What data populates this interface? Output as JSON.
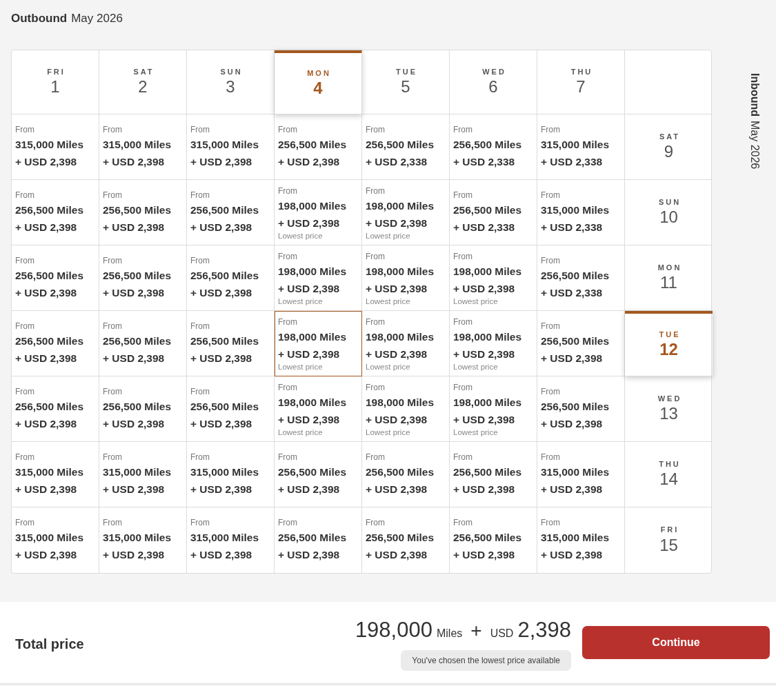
{
  "outbound": {
    "label": "Outbound",
    "month": "May 2026"
  },
  "inbound": {
    "label": "Inbound",
    "month": "May 2026"
  },
  "columns": [
    {
      "dow": "FRI",
      "day": "1",
      "selected": false
    },
    {
      "dow": "SAT",
      "day": "2",
      "selected": false
    },
    {
      "dow": "SUN",
      "day": "3",
      "selected": false
    },
    {
      "dow": "MON",
      "day": "4",
      "selected": true
    },
    {
      "dow": "TUE",
      "day": "5",
      "selected": false
    },
    {
      "dow": "WED",
      "day": "6",
      "selected": false
    },
    {
      "dow": "THU",
      "day": "7",
      "selected": false
    }
  ],
  "rows": [
    {
      "dow": "SAT",
      "day": "9",
      "selected": false,
      "cells": [
        {
          "from": "From",
          "miles": "315,000 Miles",
          "usd": "+ USD 2,398",
          "selected": false
        },
        {
          "from": "From",
          "miles": "315,000 Miles",
          "usd": "+ USD 2,398",
          "selected": false
        },
        {
          "from": "From",
          "miles": "315,000 Miles",
          "usd": "+ USD 2,398",
          "selected": false
        },
        {
          "from": "From",
          "miles": "256,500 Miles",
          "usd": "+ USD 2,398",
          "selected": false
        },
        {
          "from": "From",
          "miles": "256,500 Miles",
          "usd": "+ USD 2,338",
          "selected": false
        },
        {
          "from": "From",
          "miles": "256,500 Miles",
          "usd": "+ USD 2,338",
          "selected": false
        },
        {
          "from": "From",
          "miles": "315,000 Miles",
          "usd": "+ USD 2,338",
          "selected": false
        }
      ]
    },
    {
      "dow": "SUN",
      "day": "10",
      "selected": false,
      "cells": [
        {
          "from": "From",
          "miles": "256,500 Miles",
          "usd": "+ USD 2,398",
          "selected": false
        },
        {
          "from": "From",
          "miles": "256,500 Miles",
          "usd": "+ USD 2,398",
          "selected": false
        },
        {
          "from": "From",
          "miles": "256,500 Miles",
          "usd": "+ USD 2,398",
          "selected": false
        },
        {
          "from": "From",
          "miles": "198,000 Miles",
          "usd": "+ USD 2,398",
          "note": "Lowest price",
          "selected": false
        },
        {
          "from": "From",
          "miles": "198,000 Miles",
          "usd": "+ USD 2,398",
          "note": "Lowest price",
          "selected": false
        },
        {
          "from": "From",
          "miles": "256,500 Miles",
          "usd": "+ USD 2,338",
          "selected": false
        },
        {
          "from": "From",
          "miles": "315,000 Miles",
          "usd": "+ USD 2,338",
          "selected": false
        }
      ]
    },
    {
      "dow": "MON",
      "day": "11",
      "selected": false,
      "cells": [
        {
          "from": "From",
          "miles": "256,500 Miles",
          "usd": "+ USD 2,398",
          "selected": false
        },
        {
          "from": "From",
          "miles": "256,500 Miles",
          "usd": "+ USD 2,398",
          "selected": false
        },
        {
          "from": "From",
          "miles": "256,500 Miles",
          "usd": "+ USD 2,398",
          "selected": false
        },
        {
          "from": "From",
          "miles": "198,000 Miles",
          "usd": "+ USD 2,398",
          "note": "Lowest price",
          "selected": false
        },
        {
          "from": "From",
          "miles": "198,000 Miles",
          "usd": "+ USD 2,398",
          "note": "Lowest price",
          "selected": false
        },
        {
          "from": "From",
          "miles": "198,000 Miles",
          "usd": "+ USD 2,398",
          "note": "Lowest price",
          "selected": false
        },
        {
          "from": "From",
          "miles": "256,500 Miles",
          "usd": "+ USD 2,338",
          "selected": false
        }
      ]
    },
    {
      "dow": "TUE",
      "day": "12",
      "selected": true,
      "cells": [
        {
          "from": "From",
          "miles": "256,500 Miles",
          "usd": "+ USD 2,398",
          "selected": false
        },
        {
          "from": "From",
          "miles": "256,500 Miles",
          "usd": "+ USD 2,398",
          "selected": false
        },
        {
          "from": "From",
          "miles": "256,500 Miles",
          "usd": "+ USD 2,398",
          "selected": false
        },
        {
          "from": "From",
          "miles": "198,000 Miles",
          "usd": "+ USD 2,398",
          "note": "Lowest price",
          "selected": true
        },
        {
          "from": "From",
          "miles": "198,000 Miles",
          "usd": "+ USD 2,398",
          "note": "Lowest price",
          "selected": false
        },
        {
          "from": "From",
          "miles": "198,000 Miles",
          "usd": "+ USD 2,398",
          "note": "Lowest price",
          "selected": false
        },
        {
          "from": "From",
          "miles": "256,500 Miles",
          "usd": "+ USD 2,398",
          "selected": false
        }
      ]
    },
    {
      "dow": "WED",
      "day": "13",
      "selected": false,
      "cells": [
        {
          "from": "From",
          "miles": "256,500 Miles",
          "usd": "+ USD 2,398",
          "selected": false
        },
        {
          "from": "From",
          "miles": "256,500 Miles",
          "usd": "+ USD 2,398",
          "selected": false
        },
        {
          "from": "From",
          "miles": "256,500 Miles",
          "usd": "+ USD 2,398",
          "selected": false
        },
        {
          "from": "From",
          "miles": "198,000 Miles",
          "usd": "+ USD 2,398",
          "note": "Lowest price",
          "selected": false
        },
        {
          "from": "From",
          "miles": "198,000 Miles",
          "usd": "+ USD 2,398",
          "note": "Lowest price",
          "selected": false
        },
        {
          "from": "From",
          "miles": "198,000 Miles",
          "usd": "+ USD 2,398",
          "note": "Lowest price",
          "selected": false
        },
        {
          "from": "From",
          "miles": "256,500 Miles",
          "usd": "+ USD 2,398",
          "selected": false
        }
      ]
    },
    {
      "dow": "THU",
      "day": "14",
      "selected": false,
      "cells": [
        {
          "from": "From",
          "miles": "315,000 Miles",
          "usd": "+ USD 2,398",
          "selected": false
        },
        {
          "from": "From",
          "miles": "315,000 Miles",
          "usd": "+ USD 2,398",
          "selected": false
        },
        {
          "from": "From",
          "miles": "315,000 Miles",
          "usd": "+ USD 2,398",
          "selected": false
        },
        {
          "from": "From",
          "miles": "256,500 Miles",
          "usd": "+ USD 2,398",
          "selected": false
        },
        {
          "from": "From",
          "miles": "256,500 Miles",
          "usd": "+ USD 2,398",
          "selected": false
        },
        {
          "from": "From",
          "miles": "256,500 Miles",
          "usd": "+ USD 2,398",
          "selected": false
        },
        {
          "from": "From",
          "miles": "315,000 Miles",
          "usd": "+ USD 2,398",
          "selected": false
        }
      ]
    },
    {
      "dow": "FRI",
      "day": "15",
      "selected": false,
      "cells": [
        {
          "from": "From",
          "miles": "315,000 Miles",
          "usd": "+ USD 2,398",
          "selected": false
        },
        {
          "from": "From",
          "miles": "315,000 Miles",
          "usd": "+ USD 2,398",
          "selected": false
        },
        {
          "from": "From",
          "miles": "315,000 Miles",
          "usd": "+ USD 2,398",
          "selected": false
        },
        {
          "from": "From",
          "miles": "256,500 Miles",
          "usd": "+ USD 2,398",
          "selected": false
        },
        {
          "from": "From",
          "miles": "256,500 Miles",
          "usd": "+ USD 2,398",
          "selected": false
        },
        {
          "from": "From",
          "miles": "256,500 Miles",
          "usd": "+ USD 2,398",
          "selected": false
        },
        {
          "from": "From",
          "miles": "315,000 Miles",
          "usd": "+ USD 2,398",
          "selected": false
        }
      ]
    }
  ],
  "footer": {
    "label": "Total price",
    "miles": "198,000",
    "miles_unit": "Miles",
    "plus": "+",
    "currency": "USD",
    "amount": "2,398",
    "note": "You've chosen the lowest price available",
    "button": "Continue"
  }
}
